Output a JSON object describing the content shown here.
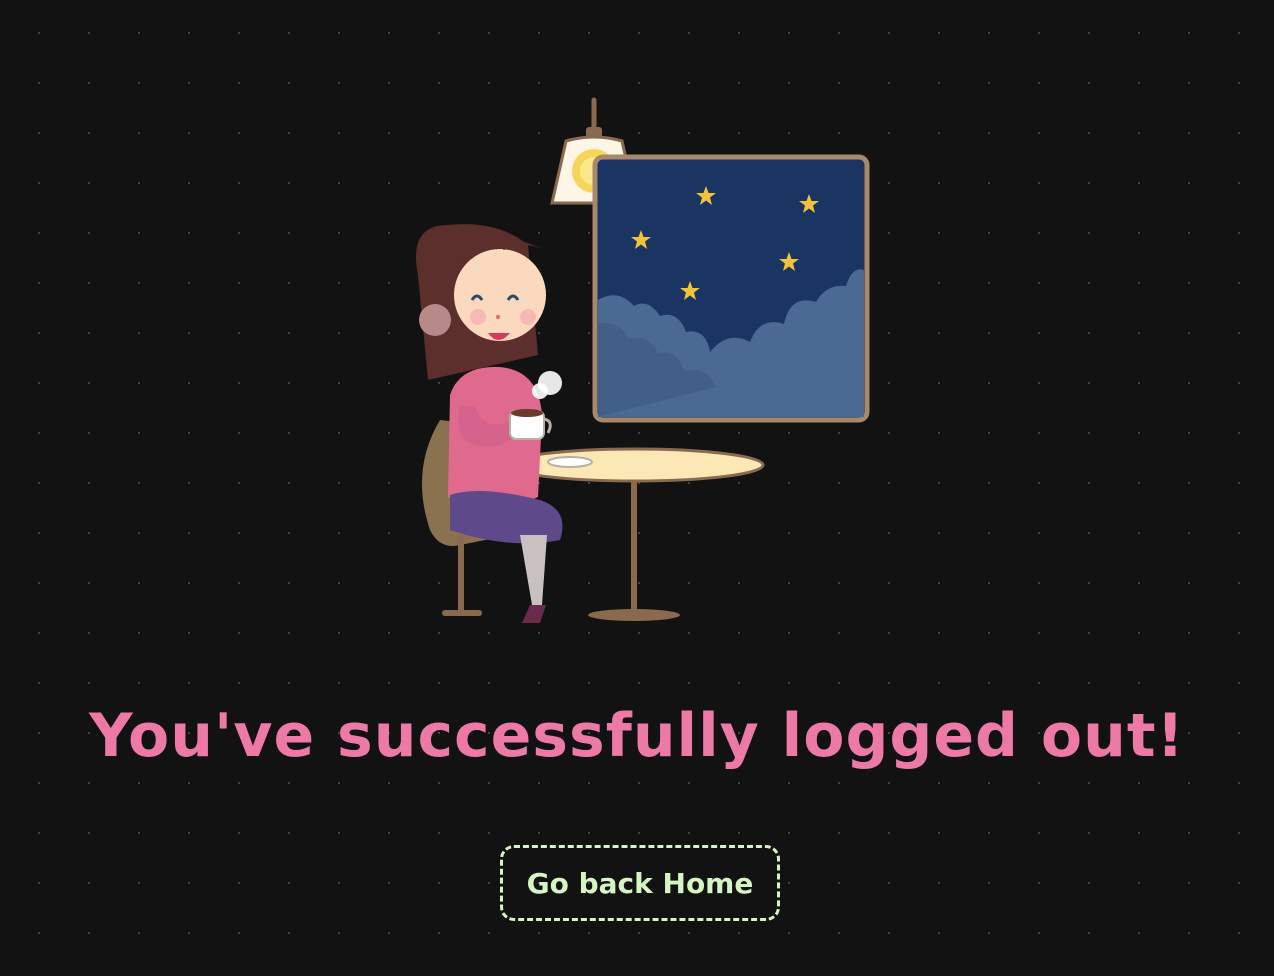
{
  "page": {
    "heading": "You've successfully logged out!",
    "home_button_label": "Go back Home"
  },
  "illustration": {
    "icon": "woman-drinking-coffee-at-night-illustration"
  },
  "colors": {
    "background": "#121212",
    "dot_grid": "#4a4a4a",
    "heading": "#ec79a6",
    "button": "#d6f5c3",
    "night_sky": "#1b3563",
    "star": "#f2c23a",
    "window_frame": "#a8886b"
  }
}
